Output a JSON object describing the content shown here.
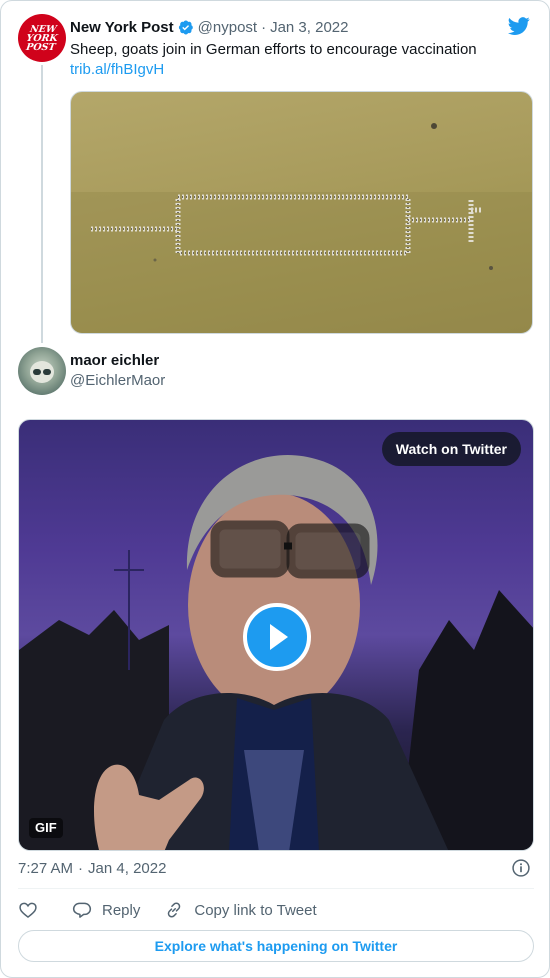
{
  "quoted_tweet": {
    "avatar_text": [
      "NEW",
      "YORK",
      "POST"
    ],
    "author_name": "New York Post",
    "verified": true,
    "handle": "@nypost",
    "separator": "·",
    "date": "Jan 3, 2022",
    "text": "Sheep, goats join in German efforts to encourage vaccination",
    "link": "trib.al/fhBIgvH"
  },
  "tweet": {
    "author_name": "maor eichler",
    "handle": "@EichlerMaor",
    "media": {
      "watch_label": "Watch on Twitter",
      "badge": "GIF"
    },
    "time": "7:27 AM",
    "separator": "·",
    "date": "Jan 4, 2022"
  },
  "actions": {
    "reply_label": "Reply",
    "copy_label": "Copy link to Tweet"
  },
  "explore_label": "Explore what's happening on Twitter",
  "icons": {
    "brand": "twitter-bird-icon",
    "verified": "verified-badge-icon",
    "play": "play-icon",
    "info": "info-icon",
    "like": "heart-icon",
    "reply": "reply-bubble-icon",
    "copy": "link-icon"
  },
  "colors": {
    "accent": "#1d9bf0",
    "text": "#0f1419",
    "secondary": "#536471",
    "border": "#cfd9de",
    "brand_red": "#d0021b"
  }
}
